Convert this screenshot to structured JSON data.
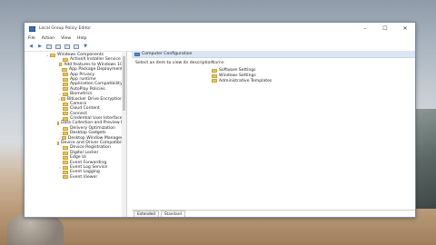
{
  "window": {
    "title": "Local Group Policy Editor",
    "controls": [
      "–",
      "☐",
      "✕"
    ]
  },
  "menu": [
    "File",
    "Action",
    "View",
    "Help"
  ],
  "toolbar_icons": [
    "back-arrow",
    "forward-arrow",
    "folder-up",
    "show-tree",
    "export-list",
    "help",
    "filter"
  ],
  "tree": {
    "items": [
      {
        "label": "Windows Components",
        "arrow": "⌄",
        "indent": 0
      },
      {
        "label": "ActiveX Installer Service",
        "arrow": "",
        "indent": 1
      },
      {
        "label": "Add features to Windows 10",
        "arrow": "",
        "indent": 1
      },
      {
        "label": "App Package Deployment",
        "arrow": "",
        "indent": 1
      },
      {
        "label": "App Privacy",
        "arrow": "",
        "indent": 1
      },
      {
        "label": "App runtime",
        "arrow": "",
        "indent": 1
      },
      {
        "label": "Application Compatibility",
        "arrow": "",
        "indent": 1
      },
      {
        "label": "AutoPlay Policies",
        "arrow": "",
        "indent": 1
      },
      {
        "label": "Biometrics",
        "arrow": "›",
        "indent": 1
      },
      {
        "label": "BitLocker Drive Encryption",
        "arrow": "›",
        "indent": 1
      },
      {
        "label": "Camera",
        "arrow": "",
        "indent": 1
      },
      {
        "label": "Cloud Content",
        "arrow": "",
        "indent": 1
      },
      {
        "label": "Connect",
        "arrow": "",
        "indent": 1
      },
      {
        "label": "Credential User Interface",
        "arrow": "",
        "indent": 1
      },
      {
        "label": "Data Collection and Preview Buil",
        "arrow": "",
        "indent": 1
      },
      {
        "label": "Delivery Optimization",
        "arrow": "",
        "indent": 1
      },
      {
        "label": "Desktop Gadgets",
        "arrow": "",
        "indent": 1
      },
      {
        "label": "Desktop Window Manager",
        "arrow": "›",
        "indent": 1
      },
      {
        "label": "Device and Driver Compatibility",
        "arrow": "",
        "indent": 1
      },
      {
        "label": "Device Registration",
        "arrow": "",
        "indent": 1
      },
      {
        "label": "Digital Locker",
        "arrow": "",
        "indent": 1
      },
      {
        "label": "Edge UI",
        "arrow": "",
        "indent": 1
      },
      {
        "label": "Event Forwarding",
        "arrow": "",
        "indent": 1
      },
      {
        "label": "Event Log Service",
        "arrow": "›",
        "indent": 1
      },
      {
        "label": "Event Logging",
        "arrow": "",
        "indent": 1
      },
      {
        "label": "Event Viewer",
        "arrow": "",
        "indent": 1
      }
    ]
  },
  "right_pane": {
    "header": "Computer Configuration",
    "description": "Select an item to view its description.",
    "column_name": "Name",
    "items": [
      "Software Settings",
      "Windows Settings",
      "Administrative Templates"
    ]
  },
  "tabs": [
    "Extended",
    "Standard"
  ]
}
